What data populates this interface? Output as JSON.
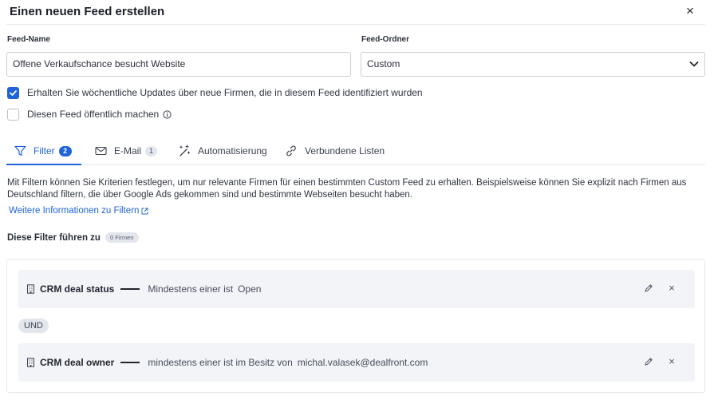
{
  "dialog": {
    "title": "Einen neuen Feed erstellen",
    "close_label": "×"
  },
  "form": {
    "feed_name_label": "Feed-Name",
    "feed_name_value": "Offene Verkaufschance besucht Website",
    "feed_folder_label": "Feed-Ordner",
    "feed_folder_value": "Custom",
    "weekly_updates_label": "Erhalten Sie wöchentliche Updates über neue Firmen, die in diesem Feed identifiziert wurden",
    "weekly_updates_checked": true,
    "public_label": "Diesen Feed öffentlich machen",
    "public_checked": false
  },
  "tabs": [
    {
      "label": "Filter",
      "badge": "2",
      "icon": "funnel-icon",
      "active": true
    },
    {
      "label": "E-Mail",
      "badge": "1",
      "icon": "mail-icon",
      "active": false
    },
    {
      "label": "Automatisierung",
      "icon": "magic-wand-icon",
      "active": false
    },
    {
      "label": "Verbundene Listen",
      "icon": "link-icon",
      "active": false
    }
  ],
  "filters_section": {
    "description": "Mit Filtern können Sie Kriterien festlegen, um nur relevante Firmen für einen bestimmten Custom Feed zu erhalten. Beispielsweise können Sie explizit nach Firmen aus Deutschland filtern, die über Google Ads gekommen sind und bestimmte Webseiten besucht haben.",
    "more_info_link": "Weitere Informationen zu Filtern",
    "result_label": "Diese Filter führen zu",
    "result_count": "0 Firmen",
    "connector": "UND",
    "filters": [
      {
        "field": "CRM deal status",
        "condition": "Mindestens einer ist",
        "value": "Open"
      },
      {
        "field": "CRM deal owner",
        "condition": "mindestens einer ist im Besitz von",
        "value": "michal.valasek@dealfront.com"
      }
    ]
  },
  "colors": {
    "accent": "#1f63d9",
    "card_bg": "#f2f4f7",
    "pill_bg": "#e3e6ec"
  }
}
